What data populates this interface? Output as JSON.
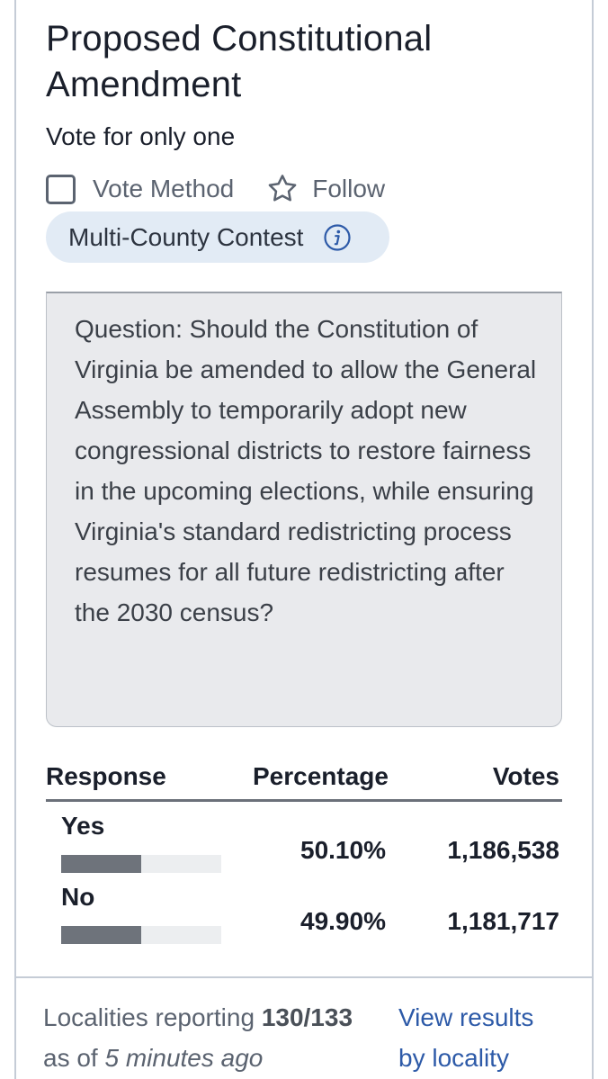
{
  "contest": {
    "title": "Proposed Constitutional Amendment",
    "instructions": "Vote for only one",
    "vote_method_label": "Vote Method",
    "follow_label": "Follow",
    "badge_label": "Multi-County Contest",
    "question": "Question: Should the Constitution of Virginia be amended to allow the General Assembly to temporarily adopt new congressional districts to restore fairness in the upcoming elections, while ensuring Virginia's standard redistricting process resumes for all future redistricting after the 2030 census?"
  },
  "results_table": {
    "headers": {
      "response": "Response",
      "percentage": "Percentage",
      "votes": "Votes"
    },
    "rows": [
      {
        "response": "Yes",
        "percentage": "50.10%",
        "votes": "1,186,538",
        "bar_fraction": 0.501
      },
      {
        "response": "No",
        "percentage": "49.90%",
        "votes": "1,181,717",
        "bar_fraction": 0.499
      }
    ]
  },
  "footer": {
    "reporting_label": "Localities reporting",
    "reporting_value": "130/133",
    "as_of_label": "as of",
    "as_of_value": "5 minutes ago",
    "link_line1": "View results",
    "link_line2": "by locality"
  },
  "colors": {
    "link": "#2d5aa8",
    "badge_background": "#e2ebf5",
    "question_background": "#e9eaed",
    "bar_fill": "#6e737b",
    "bar_track": "#eceef0"
  },
  "icons": {
    "vote_method": "checkbox-icon",
    "follow": "star-outline-icon",
    "info": "info-circle-icon"
  }
}
